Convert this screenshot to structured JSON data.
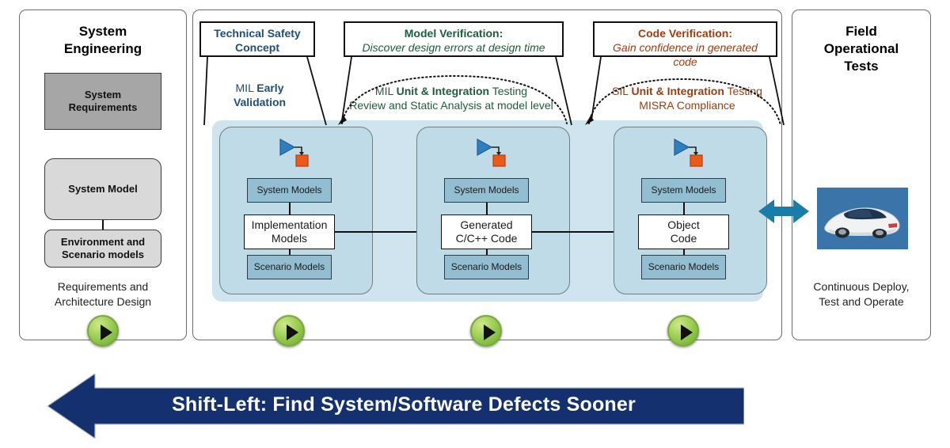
{
  "colors": {
    "blue_dark": "#1f4e79",
    "green_dark": "#1d5c3f",
    "orange_dark": "#9e3d10",
    "banner_navy": "#14306e",
    "backdrop_blue": "#cfe4ee",
    "card_blue": "#bfdbe8",
    "mini_blue": "#93bdd1",
    "req_gray": "#a6a6a6",
    "model_gray": "#d9d9d9",
    "arrow_teal": "#1a7ca8",
    "play_green": "#9ccf55"
  },
  "left_panel": {
    "title": "System\nEngineering",
    "title_line1": "System",
    "title_line2": "Engineering",
    "requirements_block": "System\nRequirements",
    "requirements_line1": "System",
    "requirements_line2": "Requirements",
    "system_model_block": "System Model",
    "environment_block_line1": "Environment and",
    "environment_block_line2": "Scenario models",
    "caption_line1": "Requirements and",
    "caption_line2": "Architecture Design"
  },
  "middle_panel": {
    "callouts": [
      {
        "id": "technical-safety-concept",
        "line1": "Technical Safety",
        "line2": "Concept",
        "color": "#1f4e79",
        "italic_second_line": false
      },
      {
        "id": "model-verification",
        "line1": "Model Verification:",
        "line2": "Discover design errors at design time",
        "color": "#1d5c3f",
        "italic_second_line": true
      },
      {
        "id": "code-verification",
        "line1": "Code Verification:",
        "line2": "Gain confidence in generated code",
        "color": "#9e3d10",
        "italic_second_line": true
      }
    ],
    "sub_labels": {
      "mil_early": {
        "line1_plain": "MIL ",
        "line1_bold": "Early",
        "line2_bold": "Validation"
      },
      "mil_unit": {
        "l1_a": "MIL ",
        "l1_b": "Unit & Integration",
        "l1_c": " Testing",
        "l2": "Review and Static Analysis at model level"
      },
      "sil_unit": {
        "l1_a": "SIL ",
        "l1_b": "Unit & Integration",
        "l1_c": " Testing",
        "l2": "MISRA Compliance"
      }
    },
    "cards": [
      {
        "top_label": "System Models",
        "main_label_line1": "Implementation",
        "main_label_line2": "Models",
        "bottom_label": "Scenario Models",
        "icon": "simulink-block-icon"
      },
      {
        "top_label": "System Models",
        "main_label_line1": "Generated",
        "main_label_line2": "C/C++ Code",
        "bottom_label": "Scenario Models",
        "icon": "simulink-block-icon"
      },
      {
        "top_label": "System Models",
        "main_label_line1": "Object",
        "main_label_line2": "Code",
        "bottom_label": "Scenario Models",
        "icon": "simulink-block-icon"
      }
    ]
  },
  "right_panel": {
    "title_line1": "Field",
    "title_line2": "Operational",
    "title_line3": "Tests",
    "image": "car-photo",
    "caption_line1": "Continuous Deploy,",
    "caption_line2": "Test and Operate"
  },
  "banner": {
    "text": "Shift-Left: Find System/Software Defects Sooner",
    "direction": "left"
  },
  "play_buttons": [
    {
      "id": "play-system-engineering"
    },
    {
      "id": "play-mil"
    },
    {
      "id": "play-sil"
    },
    {
      "id": "play-pil"
    }
  ]
}
